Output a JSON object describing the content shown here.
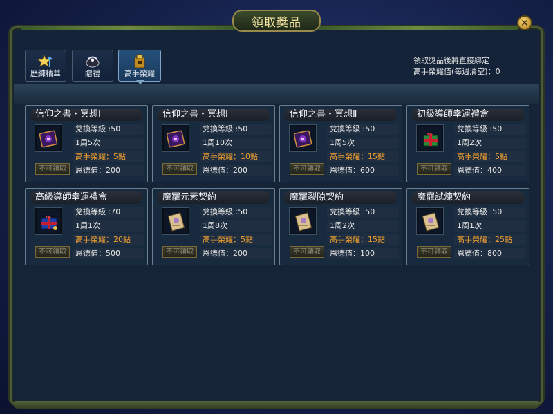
{
  "window": {
    "title": "領取獎品",
    "close_glyph": "✕"
  },
  "tabs": [
    {
      "label": "歷練精華",
      "icon": "star-arrow-icon",
      "active": false
    },
    {
      "label": "贈禮",
      "icon": "ribbon-gift-icon",
      "active": false
    },
    {
      "label": "高手榮耀",
      "icon": "gold-treasure-icon",
      "active": true
    }
  ],
  "info": {
    "line1": "領取獎品後將直接綁定",
    "line2": "高手榮耀值(每週清空)：0"
  },
  "cards": [
    {
      "name": "信仰之書・冥想Ⅰ",
      "icon": "purple-book-icon",
      "level": "兌換等級 :50",
      "limit": "1周5次",
      "cost": "高手榮耀：5點",
      "grace": "恩德值：200",
      "button": "不可領取"
    },
    {
      "name": "信仰之書・冥想Ⅰ",
      "icon": "purple-book-icon",
      "level": "兌換等級 :50",
      "limit": "1周10次",
      "cost": "高手榮耀：10點",
      "grace": "恩德值：200",
      "button": "不可領取"
    },
    {
      "name": "信仰之書・冥想Ⅱ",
      "icon": "purple-book-icon",
      "level": "兌換等級 :50",
      "limit": "1周5次",
      "cost": "高手榮耀：15點",
      "grace": "恩德值：600",
      "button": "不可領取"
    },
    {
      "name": "初級導師幸運禮盒",
      "icon": "green-gift-box-icon",
      "level": "兌換等級 :50",
      "limit": "1周2次",
      "cost": "高手榮耀：5點",
      "grace": "恩德值：400",
      "button": "不可領取"
    },
    {
      "name": "高級導師幸運禮盒",
      "icon": "blue-gift-box-icon",
      "level": "兌換等級 :70",
      "limit": "1周1次",
      "cost": "高手榮耀：20點",
      "grace": "恩德值：500",
      "button": "不可領取"
    },
    {
      "name": "魔寵元素契約",
      "icon": "contract-scroll-icon",
      "level": "兌換等級 :50",
      "limit": "1周8次",
      "cost": "高手榮耀：5點",
      "grace": "恩德值：200",
      "button": "不可領取"
    },
    {
      "name": "魔寵裂隙契約",
      "icon": "contract-scroll-icon",
      "level": "兌換等級 :50",
      "limit": "1周2次",
      "cost": "高手榮耀：15點",
      "grace": "恩德值：100",
      "button": "不可領取"
    },
    {
      "name": "魔寵試煉契約",
      "icon": "contract-scroll-icon",
      "level": "兌換等級 :50",
      "limit": "1周1次",
      "cost": "高手榮耀：25點",
      "grace": "恩德值：800",
      "button": "不可領取"
    }
  ],
  "colors": {
    "accent_orange": "#f0a030",
    "title_gold": "#f1e2a0",
    "active_tab": "#24507a"
  }
}
